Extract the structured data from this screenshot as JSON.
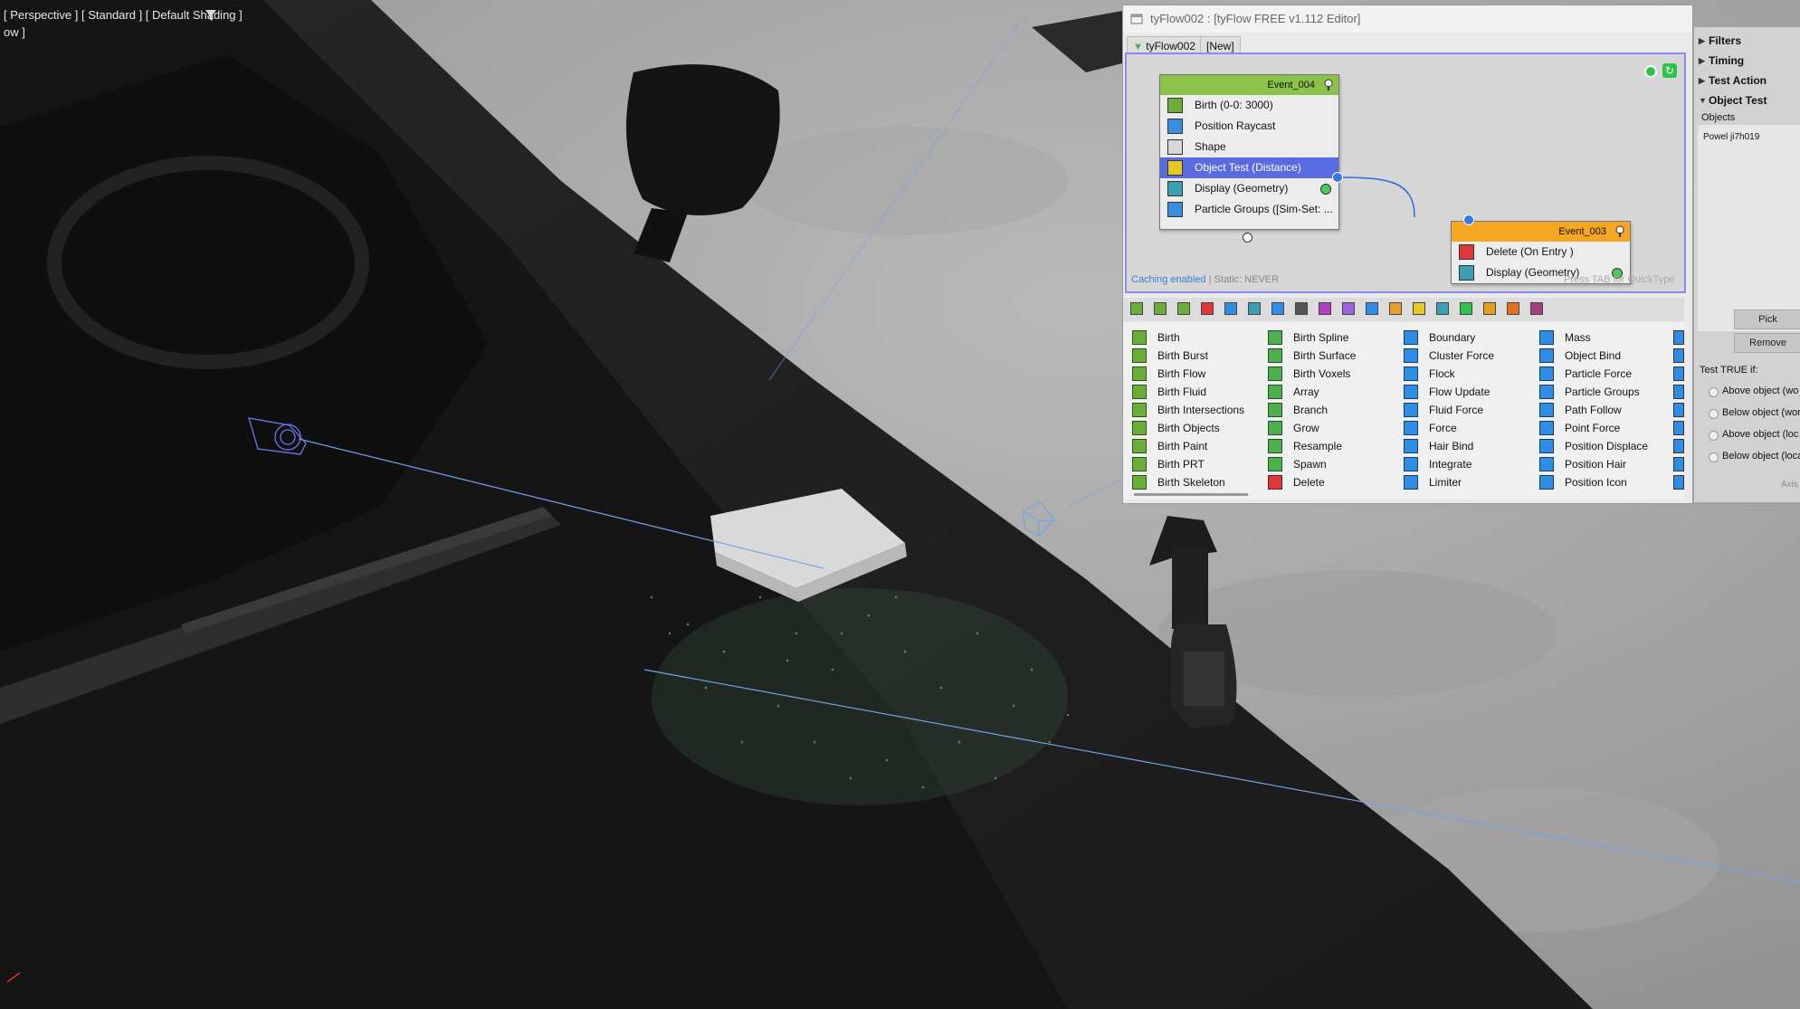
{
  "viewport": {
    "label": "[ Perspective ] [ Standard ] [ Default Shading ]",
    "label2": "ow ]"
  },
  "editor": {
    "title": "tyFlow002 : [tyFlow FREE v1.112 Editor]",
    "tabs": [
      "tyFlow002",
      "[New]"
    ],
    "caching_text": "Caching enabled",
    "static_text": " | Static: NEVER",
    "quicktype_hint": "Press TAB for QuickType",
    "events": [
      {
        "name": "Event_004",
        "header_color": "#8bc34a",
        "operators": [
          {
            "label": "Birth (0-0: 3000)",
            "icon_color": "#6cae3a",
            "selected": false
          },
          {
            "label": "Position Raycast",
            "icon_color": "#3a8fe0",
            "selected": false
          },
          {
            "label": "Shape",
            "icon_color": "#d8d8d8",
            "selected": false
          },
          {
            "label": "Object Test (Distance)",
            "icon_color": "#e8c820",
            "selected": true
          },
          {
            "label": "Display (Geometry)",
            "icon_color": "#3a9fb0",
            "selected": false
          },
          {
            "label": "Particle Groups ([Sim-Set: ...",
            "icon_color": "#3a8fe0",
            "selected": false
          }
        ]
      },
      {
        "name": "Event_003",
        "header_color": "#f5a623",
        "operators": [
          {
            "label": "Delete (On Entry )",
            "icon_color": "#e0383a",
            "selected": false
          },
          {
            "label": "Display (Geometry)",
            "icon_color": "#3a9fb0",
            "selected": false
          }
        ]
      }
    ],
    "palette": [
      [
        "Birth",
        "Birth Burst",
        "Birth Flow",
        "Birth Fluid",
        "Birth Intersections",
        "Birth Objects",
        "Birth Paint",
        "Birth PRT",
        "Birth Skeleton"
      ],
      [
        "Birth Spline",
        "Birth Surface",
        "Birth Voxels",
        "Array",
        "Branch",
        "Grow",
        "Resample",
        "Spawn",
        "Delete"
      ],
      [
        "Boundary",
        "Cluster Force",
        "Flock",
        "Flow Update",
        "Fluid Force",
        "Force",
        "Hair Bind",
        "Integrate",
        "Limiter"
      ],
      [
        "Mass",
        "Object Bind",
        "Particle Force",
        "Particle Groups",
        "Path Follow",
        "Point Force",
        "Position Displace",
        "Position Hair",
        "Position Icon"
      ]
    ],
    "palette_colors": [
      "#6cae3a",
      "#4caf50",
      "#2f8de4",
      "#2f8de4"
    ]
  },
  "right_panel": {
    "sections": [
      "Filters",
      "Timing",
      "Test Action",
      "Object Test"
    ],
    "objects_label": "Objects",
    "object_item": "Powel ji7h019",
    "pick_label": "Pick",
    "remove_label": "Remove",
    "test_true_label": "Test TRUE if:",
    "radio_options": [
      "Above object (wo",
      "Below object (wor",
      "Above object (loc",
      "Below object (loca"
    ],
    "axis_label": "Axis"
  }
}
